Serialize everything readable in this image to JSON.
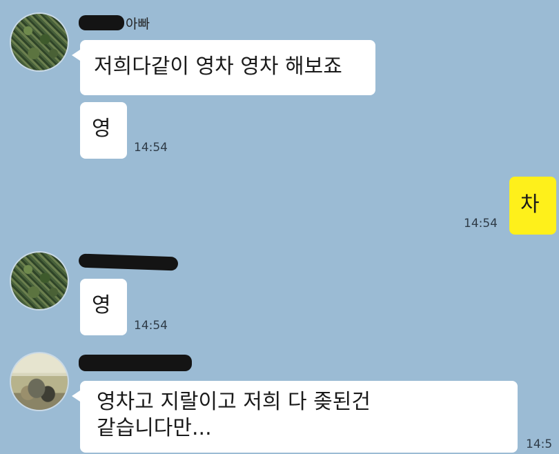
{
  "messages": [
    {
      "sender": "아빠",
      "text": "저희다같이 영차 영차 해보죠"
    },
    {
      "text": "영",
      "time": "14:54"
    },
    {
      "mine": true,
      "text": "차",
      "time": "14:54"
    },
    {
      "text": "영",
      "time": "14:54"
    },
    {
      "text_line1": "영차고 지랄이고 저희 다 좆된건",
      "text_line2": "같습니다만...",
      "time": "14:5"
    }
  ]
}
